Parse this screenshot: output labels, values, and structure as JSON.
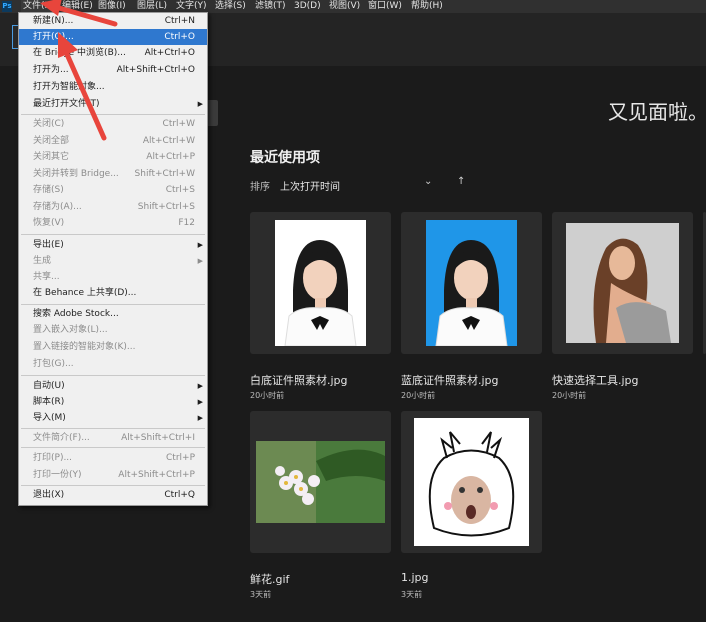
{
  "menubar": {
    "logo": "Ps",
    "items": [
      "文件(F)",
      "编辑(E)",
      "图像(I)",
      "图层(L)",
      "文字(Y)",
      "选择(S)",
      "滤镜(T)",
      "3D(D)",
      "视图(V)",
      "窗口(W)",
      "帮助(H)"
    ]
  },
  "home": {
    "welcome": "又见面啦。",
    "recent_title": "最近使用项",
    "sort_label": "排序",
    "sort_value": "上次打开时间",
    "sort_chevron": "⌄",
    "sort_arrow": "↑",
    "files": [
      {
        "name": "白底证件照素材.jpg",
        "time": "20小时前"
      },
      {
        "name": "蓝底证件照素材.jpg",
        "time": "20小时前"
      },
      {
        "name": "快速选择工具.jpg",
        "time": "20小时前"
      },
      {
        "name": "鲜花.gif",
        "time": "3天前"
      },
      {
        "name": "1.jpg",
        "time": "3天前"
      }
    ]
  },
  "file_menu": {
    "items": [
      {
        "label": "新建(N)...",
        "shortcut": "Ctrl+N",
        "disabled": false
      },
      {
        "label": "打开(O)...",
        "shortcut": "Ctrl+O",
        "disabled": false,
        "selected": true
      },
      {
        "label": "在 Bridge 中浏览(B)...",
        "shortcut": "Alt+Ctrl+O",
        "disabled": false
      },
      {
        "label": "打开为...",
        "shortcut": "Alt+Shift+Ctrl+O",
        "disabled": false
      },
      {
        "label": "打开为智能对象...",
        "shortcut": "",
        "disabled": false
      },
      {
        "label": "最近打开文件(T)",
        "shortcut": "",
        "disabled": false,
        "submenu": true
      },
      {
        "label": "关闭(C)",
        "shortcut": "Ctrl+W",
        "disabled": true
      },
      {
        "label": "关闭全部",
        "shortcut": "Alt+Ctrl+W",
        "disabled": true
      },
      {
        "label": "关闭其它",
        "shortcut": "Alt+Ctrl+P",
        "disabled": true
      },
      {
        "label": "关闭并转到 Bridge...",
        "shortcut": "Shift+Ctrl+W",
        "disabled": true
      },
      {
        "label": "存储(S)",
        "shortcut": "Ctrl+S",
        "disabled": true
      },
      {
        "label": "存储为(A)...",
        "shortcut": "Shift+Ctrl+S",
        "disabled": true
      },
      {
        "label": "恢复(V)",
        "shortcut": "F12",
        "disabled": true
      },
      {
        "label": "导出(E)",
        "shortcut": "",
        "disabled": false,
        "submenu": true
      },
      {
        "label": "生成",
        "shortcut": "",
        "disabled": true,
        "submenu": true
      },
      {
        "label": "共享...",
        "shortcut": "",
        "disabled": true
      },
      {
        "label": "在 Behance 上共享(D)...",
        "shortcut": "",
        "disabled": false
      },
      {
        "label": "搜索 Adobe Stock...",
        "shortcut": "",
        "disabled": false
      },
      {
        "label": "置入嵌入对象(L)...",
        "shortcut": "",
        "disabled": true
      },
      {
        "label": "置入链接的智能对象(K)...",
        "shortcut": "",
        "disabled": true
      },
      {
        "label": "打包(G)...",
        "shortcut": "",
        "disabled": true
      },
      {
        "label": "自动(U)",
        "shortcut": "",
        "disabled": false,
        "submenu": true
      },
      {
        "label": "脚本(R)",
        "shortcut": "",
        "disabled": false,
        "submenu": true
      },
      {
        "label": "导入(M)",
        "shortcut": "",
        "disabled": false,
        "submenu": true
      },
      {
        "label": "文件简介(F)...",
        "shortcut": "Alt+Shift+Ctrl+I",
        "disabled": true
      },
      {
        "label": "打印(P)...",
        "shortcut": "Ctrl+P",
        "disabled": true
      },
      {
        "label": "打印一份(Y)",
        "shortcut": "Alt+Shift+Ctrl+P",
        "disabled": true
      },
      {
        "label": "退出(X)",
        "shortcut": "Ctrl+Q",
        "disabled": false
      }
    ]
  },
  "colors": {
    "accent": "#2f78cf",
    "annotation": "#e8453c",
    "background": "#1b1b1b"
  }
}
